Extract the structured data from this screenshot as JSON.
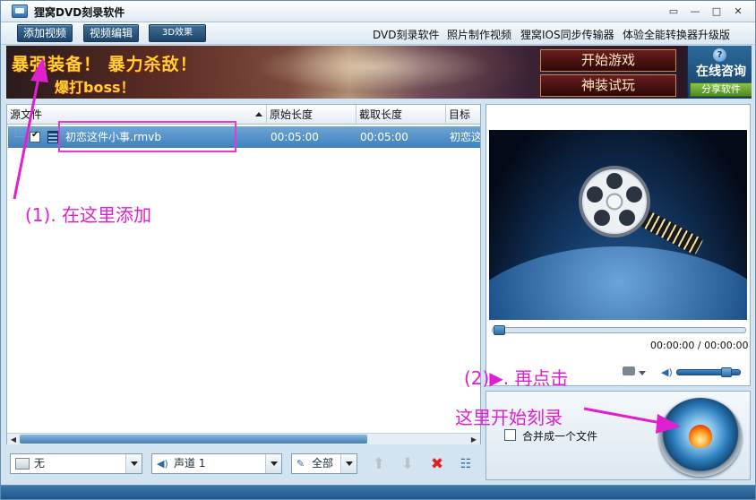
{
  "window": {
    "title": "狸窝DVD刻录软件",
    "minimize_label": "▭",
    "restore_label": "—",
    "maximize_label": "□",
    "close_label": "✕"
  },
  "toolbar": {
    "add_video": "添加视频",
    "edit_video": "视频编辑",
    "effect_3d": "3D效果",
    "links": [
      "DVD刻录软件",
      "照片制作视频",
      "狸窝IOS同步传输器",
      "体验全能转换器升级版"
    ]
  },
  "banner": {
    "slogan_line1": "暴强装备！ 暴力杀敌！",
    "slogan_line2": "爆打boss！",
    "start_game": "开始游戏",
    "try_gear": "神装试玩",
    "consult": "在线咨询",
    "consult_icon": "?",
    "share": "分享软件"
  },
  "file_list": {
    "columns": [
      "源文件",
      "原始长度",
      "截取长度",
      "目标文"
    ],
    "rows": [
      {
        "name": "初恋这件小事.rmvb",
        "original_length": "00:05:00",
        "cut_length": "00:05:00",
        "target": "初恋这"
      }
    ]
  },
  "bottom_controls": {
    "subtitle_value": "无",
    "audio_value": "声道 1",
    "scope_value": "全部"
  },
  "preview": {
    "time": "00:00:00 / 00:00:00",
    "seek_fraction": 0,
    "volume_fraction": 0.85
  },
  "burn": {
    "merge_label": "合并成一个文件"
  },
  "annotations": {
    "step1": "(1). 在这里添加",
    "step2": "(2)▶. 再点击",
    "step2_line2": "这里开始刻录"
  },
  "colors": {
    "annotation": "#e020d0",
    "selection": "#3f80bd"
  }
}
